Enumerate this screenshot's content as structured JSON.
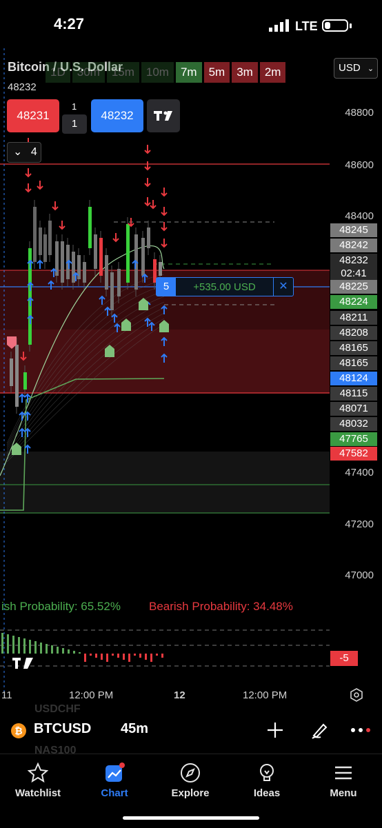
{
  "status_bar": {
    "time": "4:27",
    "network": "LTE"
  },
  "chart": {
    "title": "Bitcoin / U.S. Dollar",
    "last_price": "48232",
    "timeframes": [
      {
        "label": "1D",
        "style": "dim"
      },
      {
        "label": "30m",
        "style": "dim"
      },
      {
        "label": "15m",
        "style": "dim"
      },
      {
        "label": "10m",
        "style": "dim"
      },
      {
        "label": "7m",
        "style": "green"
      },
      {
        "label": "5m",
        "style": "red"
      },
      {
        "label": "3m",
        "style": "red"
      },
      {
        "label": "2m",
        "style": "red"
      }
    ],
    "currency": "USD",
    "bid": "48231",
    "ask": "48232",
    "spread": "1",
    "quantity": "1",
    "indicator_count": "4",
    "axis_labels": [
      "48800",
      "48600",
      "48400",
      "47400",
      "47200",
      "47000"
    ],
    "price_tags": [
      {
        "value": "48245",
        "color": "#7a7a7a"
      },
      {
        "value": "48242",
        "color": "#7a7a7a"
      },
      {
        "value": "48232",
        "color": "#2a2a2a"
      },
      {
        "value": "02:41",
        "color": "#2a2a2a"
      },
      {
        "value": "48225",
        "color": "#7a7a7a"
      },
      {
        "value": "48224",
        "color": "#3a9a42"
      },
      {
        "value": "48211",
        "color": "#3a3a3a"
      },
      {
        "value": "48208",
        "color": "#3a3a3a"
      },
      {
        "value": "48165",
        "color": "#3a3a3a"
      },
      {
        "value": "48165",
        "color": "#3a3a3a"
      },
      {
        "value": "48124",
        "color": "#2e7cf6"
      },
      {
        "value": "48115",
        "color": "#3a3a3a"
      },
      {
        "value": "48071",
        "color": "#3a3a3a"
      },
      {
        "value": "48032",
        "color": "#3a3a3a"
      },
      {
        "value": "47765",
        "color": "#3a9a42"
      },
      {
        "value": "47582",
        "color": "#e8393f"
      }
    ],
    "position": {
      "qty": "5",
      "pnl": "+535.00 USD",
      "close": "✕"
    },
    "bullish_probability_text": "ish Probability: 65.52%",
    "bearish_probability_text": "Bearish Probability: 34.48%",
    "oscillator_value": "-5",
    "time_labels": [
      "11",
      "12:00 PM",
      "12",
      "12:00 PM"
    ]
  },
  "ticker": {
    "ghost_above": "USDCHF",
    "ghost_below": "NAS100",
    "icon": "₿",
    "symbol": "BTCUSD",
    "interval": "45m"
  },
  "nav": {
    "items": [
      {
        "label": "Watchlist",
        "icon": "star-icon"
      },
      {
        "label": "Chart",
        "icon": "chart-icon",
        "active": true
      },
      {
        "label": "Explore",
        "icon": "compass-icon"
      },
      {
        "label": "Ideas",
        "icon": "lightbulb-icon"
      },
      {
        "label": "Menu",
        "icon": "menu-icon"
      }
    ]
  },
  "colors": {
    "bull": "#3a9a42",
    "bear": "#e8393f",
    "accent": "#2e7cf6"
  }
}
